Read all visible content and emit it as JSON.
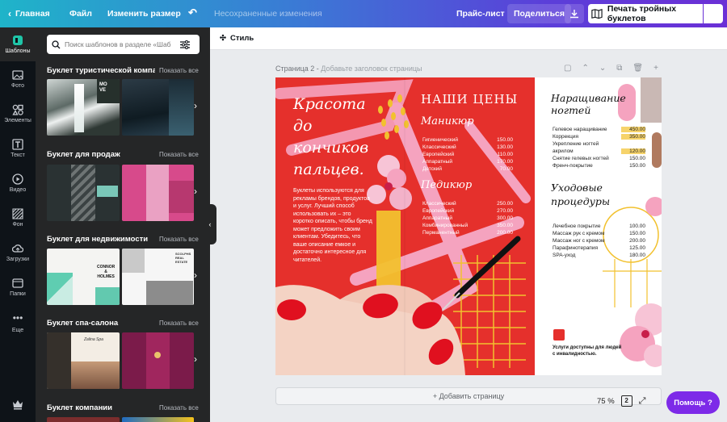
{
  "topbar": {
    "home": "Главная",
    "file": "Файл",
    "resize": "Изменить размер",
    "unsaved": "Несохраненные изменения",
    "price_list": "Прайс-лист",
    "share": "Поделиться",
    "print": "Печать тройных буклетов"
  },
  "rail": {
    "items": [
      {
        "label": "Шаблоны",
        "icon": "templates-icon"
      },
      {
        "label": "Фото",
        "icon": "photo-icon"
      },
      {
        "label": "Элементы",
        "icon": "elements-icon"
      },
      {
        "label": "Текст",
        "icon": "text-icon"
      },
      {
        "label": "Видео",
        "icon": "video-icon"
      },
      {
        "label": "Фон",
        "icon": "background-icon"
      },
      {
        "label": "Загрузки",
        "icon": "upload-icon"
      },
      {
        "label": "Папки",
        "icon": "folder-icon"
      },
      {
        "label": "Еще",
        "icon": "more-icon"
      }
    ]
  },
  "panel": {
    "search_placeholder": "Поиск шаблонов в разделе «Шаб",
    "show_all": "Показать все",
    "sections": [
      {
        "title": "Буклет туристической компа"
      },
      {
        "title": "Буклет для продаж"
      },
      {
        "title": "Буклет для недвижимости"
      },
      {
        "title": "Буклет спа-салона"
      },
      {
        "title": "Буклет компании"
      }
    ],
    "thumb_texts": {
      "move": "MO\nVE",
      "connor": "CONNOR\n&\nHOLMES",
      "estate": "SCOLPHS\nREAL\nESTATE",
      "spa": "Zalina Spa"
    }
  },
  "subbar": {
    "style": "Стиль"
  },
  "page": {
    "label": "Страница 2",
    "separator": " - ",
    "title_placeholder": "Добавьте заголовок страницы"
  },
  "brochure": {
    "headline": [
      "Красота",
      "до",
      "кончиков",
      "пальцев."
    ],
    "intro": "Буклеты используются для рекламы брендов, продуктов и услуг. Лучший способ использовать их – это коротко описать, чтобы бренд может предложить своим клиентам. Убедитесь, что ваше описание емкое и достаточно интересное для читателей.",
    "prices_title": "НАШИ ЦЕНЫ",
    "manicure_title": "Маникюр",
    "manicure": [
      {
        "name": "Гигиенический",
        "price": "150.00"
      },
      {
        "name": "Классический",
        "price": "130.00"
      },
      {
        "name": "Европейский",
        "price": "110.00"
      },
      {
        "name": "Аппаратный",
        "price": "170.00"
      },
      {
        "name": "Детский",
        "price": "70.00"
      }
    ],
    "pedicure_title": "Педикюр",
    "pedicure": [
      {
        "name": "Классический",
        "price": "250.00"
      },
      {
        "name": "Европейский",
        "price": "270.00"
      },
      {
        "name": "Аппаратный",
        "price": "300.00"
      },
      {
        "name": "Комбинированный",
        "price": "350.00"
      },
      {
        "name": "Перманентный",
        "price": "200.00"
      }
    ],
    "ext_title": [
      "Наращивание",
      "ногтей"
    ],
    "extension": [
      {
        "name": "Гелевое наращивание",
        "price": "450.00"
      },
      {
        "name": "Коррекция",
        "price": "350.00"
      },
      {
        "name": "Укрепление ногтей",
        "price": ""
      },
      {
        "name": "акрилом",
        "price": "120.00"
      },
      {
        "name": "Снятие гелевых ногтей",
        "price": "150.00"
      },
      {
        "name": "Френч-покрытие",
        "price": "150.00"
      }
    ],
    "care_title": [
      "Уходовые",
      "процедуры"
    ],
    "care": [
      {
        "name": "Лечебное покрытие",
        "price": "100.00"
      },
      {
        "name": "Массаж рук с кремом",
        "price": "150.00"
      },
      {
        "name": "Массаж ног с кремом",
        "price": "200.00"
      },
      {
        "name": "Парафинотерапия",
        "price": "125.00"
      },
      {
        "name": "SPA-уход",
        "price": "180.00"
      }
    ],
    "accessibility": "Услуги доступны для людей с инвалидностью."
  },
  "footer": {
    "add_page": "+ Добавить страницу",
    "zoom": "75 %",
    "page_count": "2",
    "help": "Помощь ?"
  },
  "colors": {
    "accent": "#7d2ae8",
    "brochure_red": "#e5302c",
    "pink": "#f5a3bf",
    "yellow": "#f2c12e"
  }
}
